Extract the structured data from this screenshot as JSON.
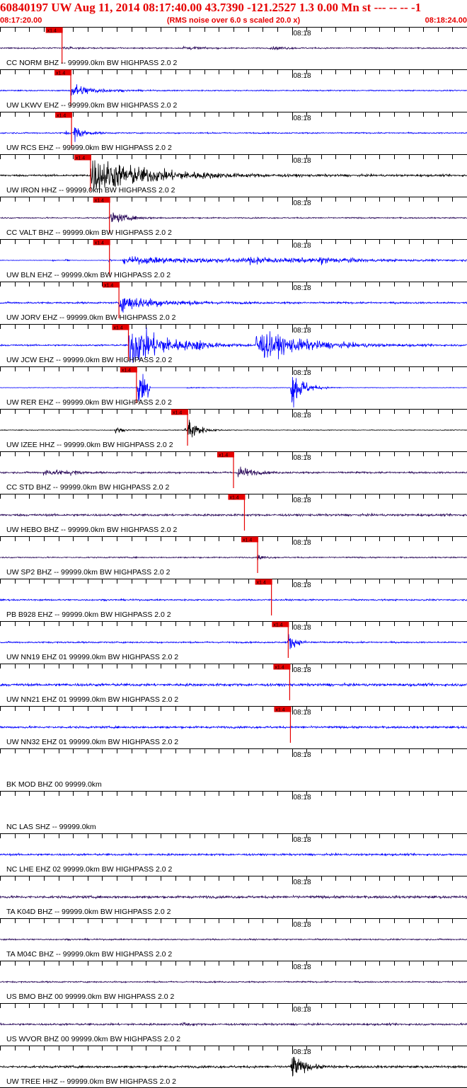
{
  "header": {
    "title": "60840197 UW Aug 11, 2014 08:17:40.00   43.7390 -121.2527  1.3 0.00 Mn st --- -- --   -1",
    "start_time": "08:17:20.00",
    "note": "(RMS noise over 6.0 s scaled 20.0 x)",
    "end_time": "08:18:24.00"
  },
  "colors": {
    "title": "#e60000",
    "pick_flag": "#e60000",
    "pick_text": "#000000",
    "blue": "#0000ff",
    "purple": "#2a0a5a",
    "black": "#000000",
    "axis": "#000000"
  },
  "chart_data": {
    "type": "line",
    "subtype": "seismogram-record-section",
    "x_range": [
      "08:17:20.00",
      "08:18:24.00"
    ],
    "x_duration_s": 64,
    "tick_interval_s": 2,
    "major_tick_label": "08:18",
    "major_tick_time": "08:18:00",
    "pick_label": "x1.4",
    "traces": [
      {
        "label": "CC NORM BHZ -- 99999.0km BW  HIGHPASS  2.0  2",
        "color": "purple",
        "pick_s": 8.5,
        "noise": 0.14,
        "events": [
          [
            8.4,
            0.3,
            1.2
          ],
          [
            25.0,
            0.5,
            1.8
          ],
          [
            37.0,
            0.3,
            1.5
          ],
          [
            37.8,
            0.25,
            1.2
          ]
        ]
      },
      {
        "label": "UW LKWV EHZ -- 99999.0km BW  HIGHPASS  2.0  2",
        "color": "blue",
        "pick_s": 9.7,
        "noise": 0.13,
        "events": [
          [
            9.6,
            2.0,
            2.5
          ]
        ]
      },
      {
        "label": "UW RCS EHZ -- 99999.0km BW  HIGHPASS  2.0  2",
        "color": "blue",
        "pick_s": 9.8,
        "noise": 0.14,
        "events": [
          [
            10.0,
            2.2,
            1.2
          ],
          [
            8.8,
            0.4,
            0.5
          ]
        ]
      },
      {
        "label": "UW IRON HHZ -- 99999.0km BW  HIGHPASS  2.0  2",
        "color": "black",
        "pick_s": 12.4,
        "noise": 0.22,
        "events": [
          [
            12.3,
            4.5,
            7.5
          ]
        ]
      },
      {
        "label": "CC VALT BHZ -- 99999.0km BW  HIGHPASS  2.0  2",
        "color": "purple",
        "pick_s": 15.0,
        "noise": 0.14,
        "events": [
          [
            15.1,
            1.6,
            2.0
          ]
        ]
      },
      {
        "label": "UW BLN EHZ -- 99999.0km BW  HIGHPASS  2.0  2",
        "color": "blue",
        "pick_s": 15.0,
        "noise": 0.05,
        "events": [
          [
            7.1,
            0.6,
            0.3
          ],
          [
            8.9,
            0.6,
            0.3
          ],
          [
            14.8,
            0.6,
            0.4
          ],
          [
            16.8,
            0.8,
            30.0
          ],
          [
            34.0,
            0.6,
            2.0
          ],
          [
            35.0,
            0.7,
            1.0
          ],
          [
            40.0,
            0.4,
            1.5
          ],
          [
            43.6,
            0.9,
            1.8
          ],
          [
            46.8,
            0.5,
            1.0
          ]
        ]
      },
      {
        "label": "UW JORV EHZ -- 99999.0km BW  HIGHPASS  2.0  2",
        "color": "blue",
        "pick_s": 16.3,
        "noise": 0.2,
        "events": [
          [
            16.2,
            2.0,
            5.0
          ]
        ]
      },
      {
        "label": "UW JCW EHZ -- 99999.0km BW  HIGHPASS  2.0  2",
        "color": "blue",
        "pick_s": 17.6,
        "noise": 0.18,
        "events": [
          [
            17.6,
            5.5,
            4.5
          ],
          [
            26.8,
            1.2,
            0.8
          ],
          [
            35.0,
            3.5,
            6.0
          ]
        ]
      },
      {
        "label": "UW RER EHZ -- 99999.0km BW  HIGHPASS  2.0  2",
        "color": "blue",
        "pick_s": 18.7,
        "noise": 0.06,
        "events": [
          [
            18.8,
            6.0,
            1.8
          ],
          [
            39.8,
            6.0,
            1.4
          ]
        ],
        "flat": [
          [
            20.6,
            25.6
          ]
        ]
      },
      {
        "label": "UW IZEE HHZ -- 99999.0km BW  HIGHPASS  2.0  2",
        "color": "black",
        "pick_s": 25.7,
        "noise": 0.08,
        "events": [
          [
            15.7,
            1.0,
            0.8
          ],
          [
            25.7,
            3.8,
            1.2
          ],
          [
            25.2,
            0.8,
            0.5
          ]
        ]
      },
      {
        "label": "CC STD BHZ -- 99999.0km BW  HIGHPASS  2.0  2",
        "color": "purple",
        "pick_s": 32.0,
        "noise": 0.2,
        "events": [
          [
            5.8,
            0.8,
            1.5
          ],
          [
            7.5,
            0.5,
            1.0
          ],
          [
            9.5,
            0.5,
            1.2
          ],
          [
            32.5,
            2.0,
            1.5
          ]
        ]
      },
      {
        "label": "UW HEBO BHZ -- 99999.0km BW  HIGHPASS  2.0  2",
        "color": "purple",
        "pick_s": 33.5,
        "noise": 0.24,
        "events": []
      },
      {
        "label": "UW SP2 BHZ -- 99999.0km BW  HIGHPASS  2.0  2",
        "color": "purple",
        "pick_s": 35.3,
        "noise": 0.14,
        "events": [
          [
            35.2,
            0.8,
            0.8
          ]
        ]
      },
      {
        "label": "PB B928 EHZ -- 99999.0km BW  HIGHPASS  2.0  2",
        "color": "blue",
        "pick_s": 37.2,
        "noise": 0.17,
        "events": []
      },
      {
        "label": "UW NN19 EHZ 01 99999.0km BW  HIGHPASS  2.0  2",
        "color": "blue",
        "pick_s": 39.5,
        "noise": 0.17,
        "events": [
          [
            39.4,
            2.3,
            1.0
          ]
        ]
      },
      {
        "label": "UW NN21 EHZ 01 99999.0km BW  HIGHPASS  2.0  2",
        "color": "blue",
        "pick_s": 39.7,
        "noise": 0.3,
        "events": []
      },
      {
        "label": "UW NN32 EHZ 01 99999.0km BW  HIGHPASS  2.0  2",
        "color": "blue",
        "pick_s": 39.8,
        "noise": 0.24,
        "events": []
      },
      {
        "label": "BK MOD BHZ 00 99999.0km",
        "color": "black",
        "pick_s": null,
        "noise": 0,
        "events": []
      },
      {
        "label": "NC LAS SHZ -- 99999.0km",
        "color": "black",
        "pick_s": null,
        "noise": 0,
        "events": []
      },
      {
        "label": "NC LHE EHZ 02 99999.0km BW  HIGHPASS  2.0  2",
        "color": "blue",
        "pick_s": null,
        "noise": 0.22,
        "events": []
      },
      {
        "label": "TA K04D BHZ -- 99999.0km BW  HIGHPASS  2.0  2",
        "color": "purple",
        "pick_s": null,
        "noise": 0.28,
        "events": []
      },
      {
        "label": "TA M04C BHZ -- 99999.0km BW  HIGHPASS  2.0  2",
        "color": "purple",
        "pick_s": null,
        "noise": 0.16,
        "events": []
      },
      {
        "label": "US BMO BHZ 00 99999.0km BW  HIGHPASS  2.0  2",
        "color": "purple",
        "pick_s": null,
        "noise": 0.16,
        "events": []
      },
      {
        "label": "US WVOR BHZ 00 99999.0km BW  HIGHPASS  2.0  2",
        "color": "purple",
        "pick_s": null,
        "noise": 0.22,
        "events": [
          [
            25.0,
            0.5,
            1.0
          ]
        ]
      },
      {
        "label": "UW TREE HHZ -- 99999.0km BW  HIGHPASS  2.0  2",
        "color": "black",
        "pick_s": null,
        "noise": 0.26,
        "events": [
          [
            39.8,
            3.5,
            1.5
          ]
        ]
      }
    ]
  }
}
